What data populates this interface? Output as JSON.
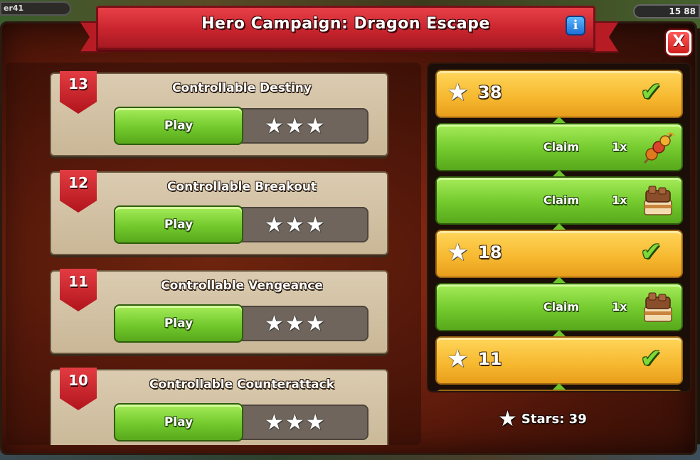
{
  "hud": {
    "player_name": "er41",
    "resource_value": "15 88"
  },
  "window": {
    "title": "Hero Campaign: Dragon Escape",
    "info_label": "i",
    "close_label": "X",
    "ribbon_color": "#c9242e"
  },
  "levels": [
    {
      "number": "13",
      "name": "Controllable Destiny",
      "play_label": "Play",
      "stars": "★★★",
      "stars_earned": 3
    },
    {
      "number": "12",
      "name": "Controllable Breakout",
      "play_label": "Play",
      "stars": "★★★",
      "stars_earned": 3
    },
    {
      "number": "11",
      "name": "Controllable Vengeance",
      "play_label": "Play",
      "stars": "★★★",
      "stars_earned": 3
    },
    {
      "number": "10",
      "name": "Controllable Counterattack",
      "play_label": "Play",
      "stars": "★★★",
      "stars_earned": 3
    }
  ],
  "rewards": {
    "rows": [
      {
        "kind": "milestone",
        "stars": "38",
        "star_icon": "★",
        "check": "✔",
        "completed": true
      },
      {
        "kind": "claim",
        "label": "Claim",
        "qty": "1x",
        "icon": "skewer-reward-icon"
      },
      {
        "kind": "claim",
        "label": "Claim",
        "qty": "1x",
        "icon": "cake-reward-icon"
      },
      {
        "kind": "milestone",
        "stars": "18",
        "star_icon": "★",
        "check": "✔",
        "completed": true
      },
      {
        "kind": "claim",
        "label": "Claim",
        "qty": "1x",
        "icon": "cake-reward-icon"
      },
      {
        "kind": "milestone",
        "stars": "11",
        "star_icon": "★",
        "check": "✔",
        "completed": true
      }
    ]
  },
  "stars_total": {
    "star_icon": "★",
    "label": "Stars: 39"
  }
}
